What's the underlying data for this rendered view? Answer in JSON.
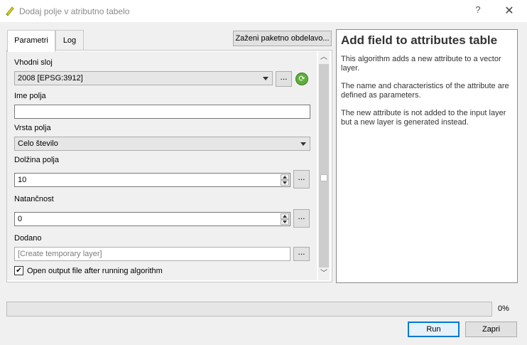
{
  "window": {
    "title": "Dodaj polje v atributno tabelo",
    "help_glyph": "?",
    "close_glyph": "✕",
    "icon": "qgis-icon"
  },
  "tabs": [
    {
      "label": "Parametri",
      "active": true
    },
    {
      "label": "Log",
      "active": false
    }
  ],
  "batch_button": "Zaženi paketno obdelavo...",
  "form": {
    "input_layer": {
      "label": "Vhodni sloj",
      "value": "2008 [EPSG:3912]",
      "browse": "...",
      "refresh_icon": "refresh-icon"
    },
    "field_name": {
      "label": "Ime polja",
      "value": ""
    },
    "field_type": {
      "label": "Vrsta polja",
      "value": "Celo število"
    },
    "field_length": {
      "label": "Dolžina polja",
      "value": "10",
      "browse": "..."
    },
    "precision": {
      "label": "Natančnost",
      "value": "0",
      "browse": "..."
    },
    "output": {
      "label": "Dodano",
      "placeholder": "[Create temporary layer]",
      "browse": "..."
    },
    "open_output": {
      "label": "Open output file after running algorithm",
      "checked": true,
      "check_glyph": "✔"
    }
  },
  "scrollbar": {
    "up_glyph": "︿",
    "down_glyph": "﹀"
  },
  "help": {
    "title": "Add field to attributes table",
    "paragraphs": [
      "This algorithm adds a new attribute to a vector layer.",
      "The name and characteristics of the attribute are defined as parameters.",
      "The new attribute is not added to the input layer but a new layer is generated instead."
    ]
  },
  "progress": {
    "value": 0,
    "label": "0%"
  },
  "buttons": {
    "run": "Run",
    "close": "Zapri"
  },
  "colors": {
    "accent": "#0078d7",
    "progress": "#06b025"
  }
}
